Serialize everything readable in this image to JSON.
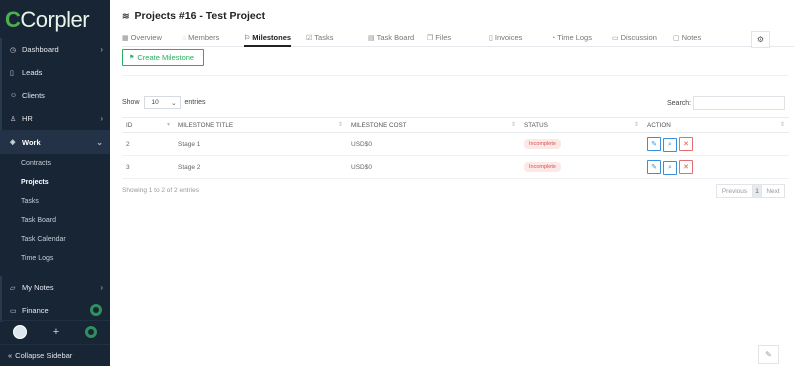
{
  "app": {
    "logo_c": "C",
    "logo_text": "Corpler"
  },
  "sidebar": {
    "items": [
      {
        "label": "Dashboard",
        "icon": "dashboard-icon",
        "glyph": "◷"
      },
      {
        "label": "Leads",
        "icon": "leads-icon",
        "glyph": "▯"
      },
      {
        "label": "Clients",
        "icon": "clients-icon",
        "glyph": "☺"
      },
      {
        "label": "HR",
        "icon": "hr-icon",
        "glyph": "♙"
      },
      {
        "label": "Work",
        "icon": "work-icon",
        "glyph": "◈"
      }
    ],
    "work_sub": [
      "Contracts",
      "Projects",
      "Tasks",
      "Task Board",
      "Task Calendar",
      "Time Logs"
    ],
    "my_notes": "My Notes",
    "finance": "Finance",
    "collapse": "Collapse Sidebar",
    "collapse_glyph": "«"
  },
  "page": {
    "title": "Projects #16 - Test Project",
    "title_icon": "layers-icon"
  },
  "tabs": [
    {
      "label": "Overview",
      "glyph": "▦"
    },
    {
      "label": "Members",
      "glyph": "◌"
    },
    {
      "label": "Milestones",
      "glyph": "⚐"
    },
    {
      "label": "Tasks",
      "glyph": "☑"
    },
    {
      "label": "Task Board",
      "glyph": "▤"
    },
    {
      "label": "Files",
      "glyph": "❐"
    },
    {
      "label": "Invoices",
      "glyph": "▯"
    },
    {
      "label": "Time Logs",
      "glyph": "◔"
    },
    {
      "label": "Discussion",
      "glyph": "▭"
    },
    {
      "label": "Notes",
      "glyph": "▢"
    }
  ],
  "toolbar": {
    "create_label": "Create Milestone",
    "create_glyph": "⚑"
  },
  "list_controls": {
    "show": "Show",
    "entries_value": "10",
    "entries": "entries",
    "search": "Search:"
  },
  "table": {
    "columns": [
      "ID",
      "MILESTONE TITLE",
      "MILESTONE COST",
      "STATUS",
      "ACTION"
    ],
    "rows": [
      {
        "id": "2",
        "title": "Stage 1",
        "cost": "USD$0",
        "status": "Incomplete"
      },
      {
        "id": "3",
        "title": "Stage 2",
        "cost": "USD$0",
        "status": "Incomplete"
      }
    ]
  },
  "footer": {
    "info": "Showing 1 to 2 of 2 entries",
    "prev": "Previous",
    "page": "1",
    "next": "Next"
  },
  "colors": {
    "sidebar": "#182535",
    "accent_green": "#27ae60",
    "status_red": "#d9534f",
    "action_blue": "#3a8fd8"
  }
}
